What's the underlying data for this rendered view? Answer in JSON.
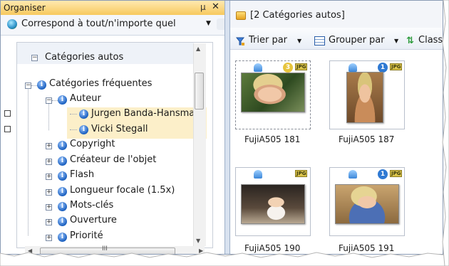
{
  "left_panel": {
    "title": "Organiser",
    "pin_glyph": "μ",
    "close_glyph": "✕",
    "match_label": "Correspond à tout/n'importe quel",
    "match_icon": "globe-icon",
    "tree": {
      "root": "Catégories autos",
      "group": "Catégories fréquentes",
      "author": "Auteur",
      "author_children": [
        "Jurgen Banda-Hansman",
        "Vicki Stegall"
      ],
      "items": [
        "Copyright",
        "Créateur de l'objet",
        "Flash",
        "Longueur focale (1.5x)",
        "Mots-clés",
        "Ouverture",
        "Priorité"
      ]
    },
    "scroll_grip": "III"
  },
  "right_panel": {
    "path": "[2 Catégories autos]",
    "toolbar": {
      "sort_label": "Trier par",
      "group_label": "Grouper par",
      "class_label": "Class"
    },
    "thumbnails": [
      {
        "caption": "FujiA505 181",
        "badge": "3",
        "badge_color": "#e7c43c",
        "selected": true
      },
      {
        "caption": "FujiA505 187",
        "badge": "1",
        "badge_color": "#2f79d3",
        "selected": false
      },
      {
        "caption": "FujiA505 190",
        "badge": "",
        "badge_color": "",
        "selected": false
      },
      {
        "caption": "FujiA505 191",
        "badge": "1",
        "badge_color": "#2f79d3",
        "selected": false
      }
    ],
    "file_type": "JPG"
  },
  "colors": {
    "header_gold": "#f7c95e",
    "selection_highlight": "#fcefc9",
    "info_blue": "#1a5fbf"
  }
}
